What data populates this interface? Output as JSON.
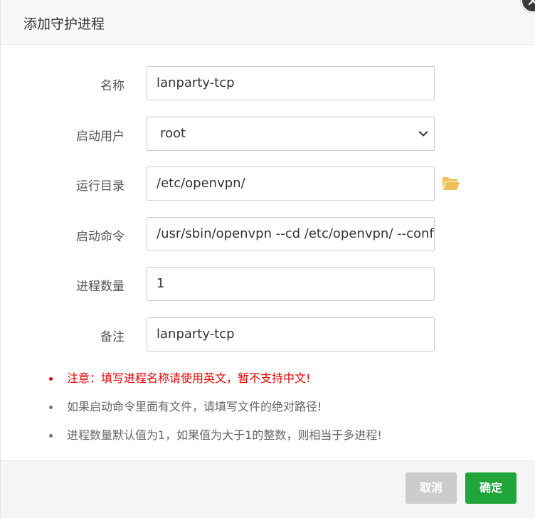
{
  "dialog": {
    "title": "添加守护进程"
  },
  "form": {
    "name": {
      "label": "名称",
      "value": "lanparty-tcp"
    },
    "user": {
      "label": "启动用户",
      "value": "root"
    },
    "run_dir": {
      "label": "运行目录",
      "value": "/etc/openvpn/"
    },
    "command": {
      "label": "启动命令",
      "value": "/usr/sbin/openvpn --cd /etc/openvpn/ --config"
    },
    "process_count": {
      "label": "进程数量",
      "value": "1"
    },
    "remark": {
      "label": "备注",
      "value": "lanparty-tcp"
    }
  },
  "notes": [
    "注意：填写进程名称请使用英文，暂不支持中文!",
    "如果启动命令里面有文件，请填写文件的绝对路径!",
    "进程数量默认值为1，如果值为大于1的整数，则相当于多进程!"
  ],
  "buttons": {
    "cancel": "取消",
    "confirm": "确定"
  },
  "colors": {
    "confirm": "#20a53a",
    "cancel": "#cccccc",
    "warning": "#e60000",
    "folder": "#f0c05a"
  }
}
